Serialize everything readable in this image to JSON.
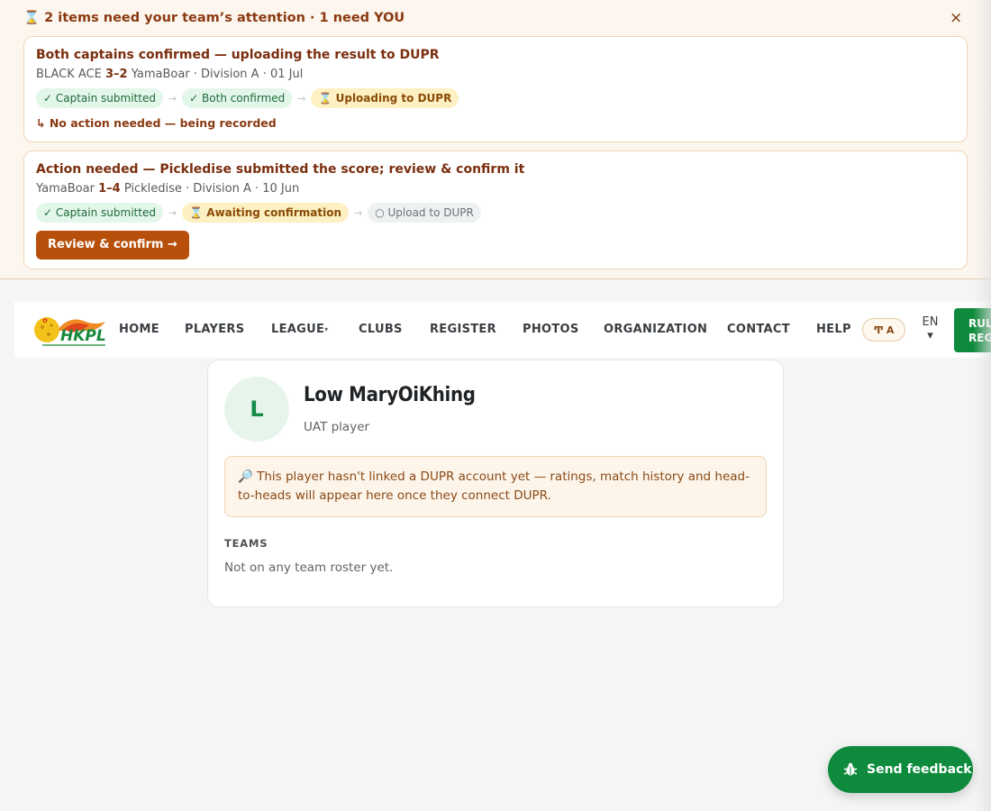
{
  "banner": {
    "title": "⌛ 2 items need your team’s attention · 1 need YOU",
    "close": "×",
    "cards": [
      {
        "title": "Both captains confirmed — uploading the result to DUPR",
        "team_a": "BLACK ACE",
        "score": "3–2",
        "team_b": "YamaBoar",
        "meta": "· Division A · 01 Jul",
        "steps": [
          "✓ Captain submitted",
          "✓ Both confirmed",
          "⌛ Uploading to DUPR"
        ],
        "note": "↳ No action needed — being recorded"
      },
      {
        "title": "Action needed — Pickledise submitted the score; review & confirm it",
        "team_a": "YamaBoar",
        "score": "1–4",
        "team_b": "Pickledise",
        "meta": "· Division A · 10 Jun",
        "steps": [
          "✓ Captain submitted",
          "⌛ Awaiting confirmation",
          "○ Upload to DUPR"
        ],
        "button": "Review & confirm →"
      }
    ],
    "arrow": "→"
  },
  "nav": {
    "logo_text": "HKPL",
    "items": [
      "HOME",
      "PLAYERS",
      "LEAGUE",
      "CLUBS",
      "REGISTER",
      "PHOTOS",
      "ORGANIZATION",
      "CONTACT",
      "HELP"
    ],
    "league_caret": "▾",
    "text_size_icon": "Ͳ",
    "text_size_label": "A",
    "lang": "EN",
    "lang_caret": "▾",
    "rules_line1": "RULES",
    "rules_line2": "REGS"
  },
  "profile": {
    "initial": "L",
    "name": "Low MaryOiKhing",
    "subtitle": "UAT player",
    "notice": "🔎 This player hasn't linked a DUPR account yet — ratings, match history and head-to-heads will appear here once they connect DUPR.",
    "teams_heading": "TEAMS",
    "teams_empty": "Not on any team roster yet."
  },
  "feedback": {
    "label": "Send feedback",
    "icon": "bug-icon"
  },
  "colors": {
    "brand_green": "#0d8a3b",
    "accent_orange": "#b8500c",
    "banner_bg": "#fdf6ee"
  }
}
